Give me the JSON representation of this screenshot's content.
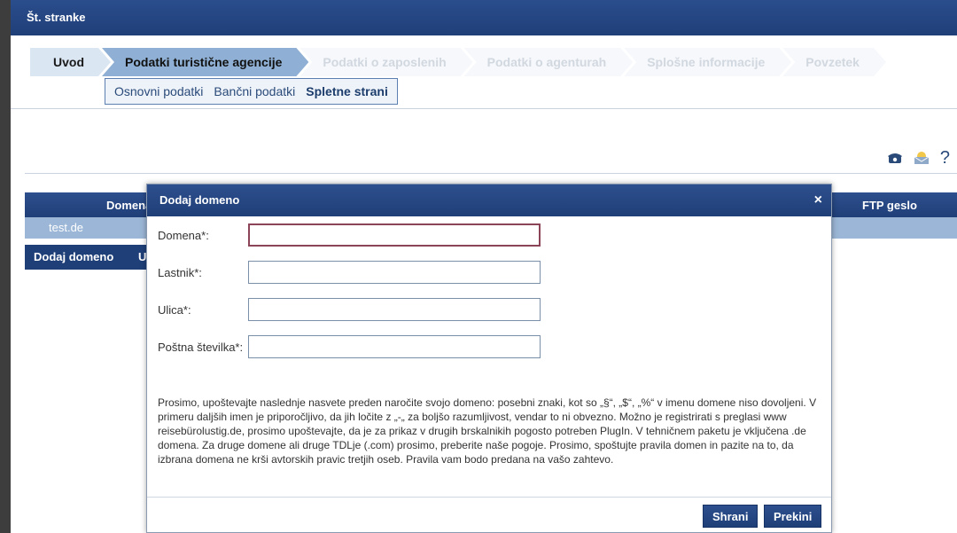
{
  "header": {
    "title": "Št. stranke"
  },
  "steps": [
    {
      "label": "Uvod",
      "state": "done"
    },
    {
      "label": "Podatki turistične agencije",
      "state": "active"
    },
    {
      "label": "Podatki o zaposlenih",
      "state": "disabled"
    },
    {
      "label": "Podatki o agenturah",
      "state": "disabled"
    },
    {
      "label": "Splošne informacije",
      "state": "disabled"
    },
    {
      "label": "Povzetek",
      "state": "disabled"
    }
  ],
  "subtabs": [
    {
      "label": "Osnovni podatki"
    },
    {
      "label": "Bančni podatki"
    },
    {
      "label": "Spletne strani",
      "current": true
    }
  ],
  "icons": {
    "phone": "phone-icon",
    "mail": "mail-icon",
    "help": "?"
  },
  "table": {
    "columns": [
      "Domena",
      "FTP geslo"
    ],
    "rows": [
      [
        "test.de"
      ]
    ],
    "buttons": [
      "Dodaj domeno",
      "U"
    ]
  },
  "modal": {
    "title": "Dodaj domeno",
    "close": "×",
    "fields": [
      {
        "label": "Domena*:",
        "value": ""
      },
      {
        "label": "Lastnik*:",
        "value": ""
      },
      {
        "label": "Ulica*:",
        "value": ""
      },
      {
        "label": "Poštna številka*:",
        "value": ""
      }
    ],
    "notice": "Prosimo, upoštevajte naslednje nasvete preden naročite svojo domeno: posebni znaki, kot so „§“, „$“, „%“ v imenu domene niso dovoljeni. V primeru daljših imen je priporočljivo, da jih ločite z „-„ za boljšo razumljivost, vendar to ni obvezno. Možno je registrirati s preglasi www reisebürolustig.de, prosimo upoštevajte, da je za prikaz v drugih brskalnikih pogosto potreben PlugIn. V tehničnem paketu je vključena .de domena. Za druge domene ali druge TDLje (.com) prosimo, preberite naše pogoje. Prosimo, spoštujte pravila domen in pazite na to, da izbrana domena ne krši avtorskih pravic tretjih oseb. Pravila vam bodo predana na vašo zahtevo.",
    "save": "Shrani",
    "cancel": "Prekini"
  }
}
